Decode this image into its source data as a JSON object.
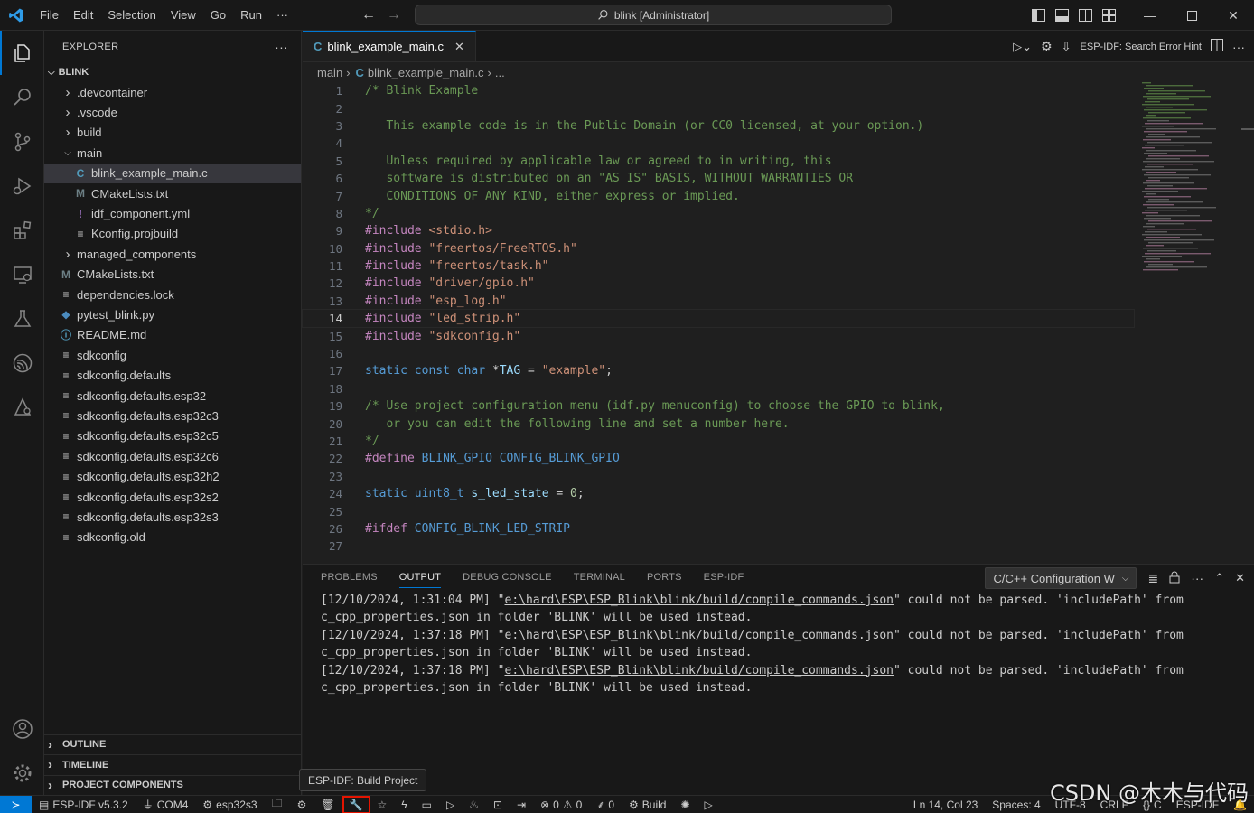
{
  "titlebar": {
    "menus": [
      "File",
      "Edit",
      "Selection",
      "View",
      "Go",
      "Run"
    ],
    "more": "···",
    "search_text": "blink [Administrator]"
  },
  "sidebar": {
    "title": "EXPLORER",
    "more": "···",
    "root": "BLINK",
    "items": [
      {
        "label": ".devcontainer",
        "type": "folder",
        "depth": 1,
        "open": false
      },
      {
        "label": ".vscode",
        "type": "folder",
        "depth": 1,
        "open": false
      },
      {
        "label": "build",
        "type": "folder",
        "depth": 1,
        "open": false
      },
      {
        "label": "main",
        "type": "folder",
        "depth": 1,
        "open": true
      },
      {
        "label": "blink_example_main.c",
        "type": "c",
        "depth": 2,
        "selected": true
      },
      {
        "label": "CMakeLists.txt",
        "type": "cmake",
        "depth": 2
      },
      {
        "label": "idf_component.yml",
        "type": "yml",
        "depth": 2
      },
      {
        "label": "Kconfig.projbuild",
        "type": "text",
        "depth": 2
      },
      {
        "label": "managed_components",
        "type": "folder",
        "depth": 1,
        "open": false
      },
      {
        "label": "CMakeLists.txt",
        "type": "cmake",
        "depth": 1
      },
      {
        "label": "dependencies.lock",
        "type": "text",
        "depth": 1
      },
      {
        "label": "pytest_blink.py",
        "type": "python",
        "depth": 1
      },
      {
        "label": "README.md",
        "type": "info",
        "depth": 1
      },
      {
        "label": "sdkconfig",
        "type": "text",
        "depth": 1
      },
      {
        "label": "sdkconfig.defaults",
        "type": "text",
        "depth": 1
      },
      {
        "label": "sdkconfig.defaults.esp32",
        "type": "text",
        "depth": 1
      },
      {
        "label": "sdkconfig.defaults.esp32c3",
        "type": "text",
        "depth": 1
      },
      {
        "label": "sdkconfig.defaults.esp32c5",
        "type": "text",
        "depth": 1
      },
      {
        "label": "sdkconfig.defaults.esp32c6",
        "type": "text",
        "depth": 1
      },
      {
        "label": "sdkconfig.defaults.esp32h2",
        "type": "text",
        "depth": 1
      },
      {
        "label": "sdkconfig.defaults.esp32s2",
        "type": "text",
        "depth": 1
      },
      {
        "label": "sdkconfig.defaults.esp32s3",
        "type": "text",
        "depth": 1
      },
      {
        "label": "sdkconfig.old",
        "type": "text",
        "depth": 1
      }
    ],
    "bottom_sections": [
      "OUTLINE",
      "TIMELINE",
      "PROJECT COMPONENTS"
    ]
  },
  "editor": {
    "tab_label": "blink_example_main.c",
    "tab_icon": "C",
    "action_label": "ESP-IDF: Search Error Hint",
    "breadcrumb": [
      "main",
      "blink_example_main.c",
      "..."
    ],
    "current_line": 14,
    "lines": [
      [
        [
          "c-com",
          "/* Blink Example"
        ]
      ],
      [],
      [
        [
          "c-com",
          "   This example code is in the Public Domain (or CC0 licensed, at your option.)"
        ]
      ],
      [],
      [
        [
          "c-com",
          "   Unless required by applicable law or agreed to in writing, this"
        ]
      ],
      [
        [
          "c-com",
          "   software is distributed on an \"AS IS\" BASIS, WITHOUT WARRANTIES OR"
        ]
      ],
      [
        [
          "c-com",
          "   CONDITIONS OF ANY KIND, either express or implied."
        ]
      ],
      [
        [
          "c-com",
          "*/"
        ]
      ],
      [
        [
          "c-kw",
          "#include "
        ],
        [
          "c-str",
          "<stdio.h>"
        ]
      ],
      [
        [
          "c-kw",
          "#include "
        ],
        [
          "c-str",
          "\"freertos/FreeRTOS.h\""
        ]
      ],
      [
        [
          "c-kw",
          "#include "
        ],
        [
          "c-str",
          "\"freertos/task.h\""
        ]
      ],
      [
        [
          "c-kw",
          "#include "
        ],
        [
          "c-str",
          "\"driver/gpio.h\""
        ]
      ],
      [
        [
          "c-kw",
          "#include "
        ],
        [
          "c-str",
          "\"esp_log.h\""
        ]
      ],
      [
        [
          "c-kw",
          "#include "
        ],
        [
          "c-str",
          "\"led_strip.h\""
        ]
      ],
      [
        [
          "c-kw",
          "#include "
        ],
        [
          "c-str",
          "\"sdkconfig.h\""
        ]
      ],
      [],
      [
        [
          "c-type",
          "static const char "
        ],
        [
          "",
          "*"
        ],
        [
          "c-var",
          "TAG"
        ],
        [
          "",
          " = "
        ],
        [
          "c-str",
          "\"example\""
        ],
        [
          "",
          ";"
        ]
      ],
      [],
      [
        [
          "c-com",
          "/* Use project configuration menu (idf.py menuconfig) to choose the GPIO to blink,"
        ]
      ],
      [
        [
          "c-com",
          "   or you can edit the following line and set a number here."
        ]
      ],
      [
        [
          "c-com",
          "*/"
        ]
      ],
      [
        [
          "c-kw",
          "#define "
        ],
        [
          "c-macro",
          "BLINK_GPIO CONFIG_BLINK_GPIO"
        ]
      ],
      [],
      [
        [
          "c-type",
          "static "
        ],
        [
          "c-type",
          "uint8_t "
        ],
        [
          "c-var",
          "s_led_state"
        ],
        [
          "",
          " = "
        ],
        [
          "c-num",
          "0"
        ],
        [
          "",
          ";"
        ]
      ],
      [],
      [
        [
          "c-kw",
          "#ifdef "
        ],
        [
          "c-macro",
          "CONFIG_BLINK_LED_STRIP"
        ]
      ],
      []
    ]
  },
  "panel": {
    "tabs": [
      "PROBLEMS",
      "OUTPUT",
      "DEBUG CONSOLE",
      "TERMINAL",
      "PORTS",
      "ESP-IDF"
    ],
    "active_tab": "OUTPUT",
    "output_channel": "C/C++ Configuration W",
    "output_lines": [
      {
        "pre": "[12/10/2024, 1:31:04 PM] \"",
        "path": "e:\\hard\\ESP\\ESP_Blink\\blink/build/compile_commands.json",
        "post": "\" could not be parsed. 'includePath' from"
      },
      {
        "text": "c_cpp_properties.json in folder 'BLINK' will be used instead."
      },
      {
        "pre": "[12/10/2024, 1:37:18 PM] \"",
        "path": "e:\\hard\\ESP\\ESP_Blink\\blink/build/compile_commands.json",
        "post": "\" could not be parsed. 'includePath' from"
      },
      {
        "text": "c_cpp_properties.json in folder 'BLINK' will be used instead."
      },
      {
        "pre": "[12/10/2024, 1:37:18 PM] \"",
        "path": "e:\\hard\\ESP\\ESP_Blink\\blink/build/compile_commands.json",
        "post": "\" could not be parsed. 'includePath' from"
      },
      {
        "text": "c_cpp_properties.json in folder 'BLINK' will be used instead."
      }
    ]
  },
  "tooltip": {
    "text": "ESP-IDF: Build Project"
  },
  "statusbar": {
    "idf_version": "ESP-IDF v5.3.2",
    "port": "COM4",
    "target": "esp32s3",
    "errors": "0",
    "warnings": "0",
    "ports_count": "0",
    "build_label": "Build",
    "position": "Ln 14, Col 23",
    "spaces": "Spaces: 4",
    "encoding": "UTF-8",
    "eol": "CRLF",
    "language": "C",
    "idf_label": "ESP-IDF"
  },
  "watermark": "CSDN @木木与代码",
  "colors": {
    "accent": "#0078d4",
    "highlight_box": "#e51400"
  }
}
